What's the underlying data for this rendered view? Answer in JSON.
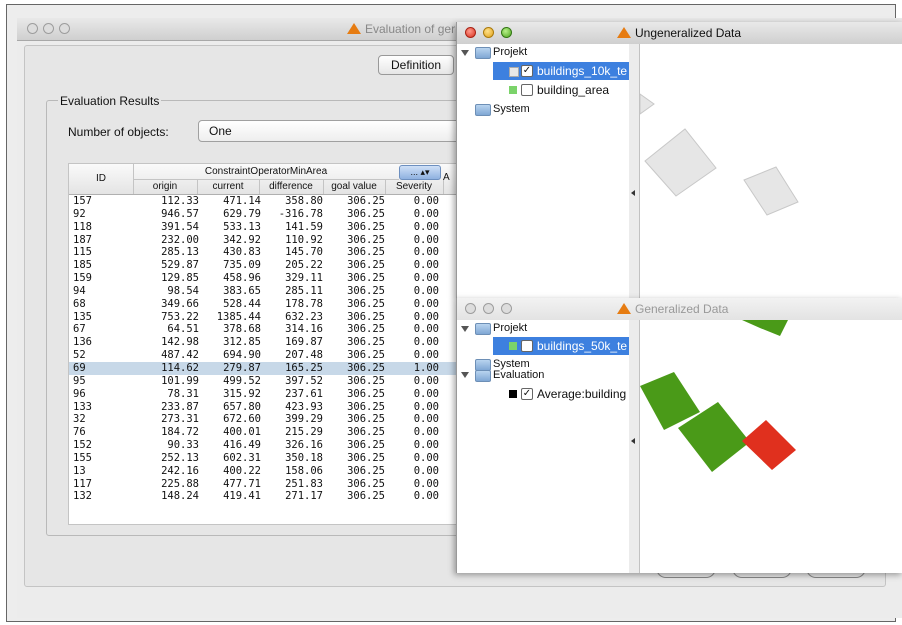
{
  "main_window": {
    "title": "Evaluation of ger",
    "tab": "Definition",
    "group_title": "Evaluation Results",
    "objects_label": "Number of objects:",
    "objects_value": "One",
    "table": {
      "col_id": "ID",
      "group_header": "ConstraintOperatorMinArea",
      "group_button": "...",
      "extra_col": "A",
      "sub_headers": [
        "origin",
        "current",
        "difference",
        "goal value",
        "Severity"
      ],
      "rows": [
        [
          "157",
          "112.33",
          "471.14",
          "358.80",
          "306.25",
          "0.00"
        ],
        [
          "92",
          "946.57",
          "629.79",
          "-316.78",
          "306.25",
          "0.00"
        ],
        [
          "118",
          "391.54",
          "533.13",
          "141.59",
          "306.25",
          "0.00"
        ],
        [
          "187",
          "232.00",
          "342.92",
          "110.92",
          "306.25",
          "0.00"
        ],
        [
          "115",
          "285.13",
          "430.83",
          "145.70",
          "306.25",
          "0.00"
        ],
        [
          "185",
          "529.87",
          "735.09",
          "205.22",
          "306.25",
          "0.00"
        ],
        [
          "159",
          "129.85",
          "458.96",
          "329.11",
          "306.25",
          "0.00"
        ],
        [
          "94",
          "98.54",
          "383.65",
          "285.11",
          "306.25",
          "0.00"
        ],
        [
          "68",
          "349.66",
          "528.44",
          "178.78",
          "306.25",
          "0.00"
        ],
        [
          "135",
          "753.22",
          "1385.44",
          "632.23",
          "306.25",
          "0.00"
        ],
        [
          "67",
          "64.51",
          "378.68",
          "314.16",
          "306.25",
          "0.00"
        ],
        [
          "136",
          "142.98",
          "312.85",
          "169.87",
          "306.25",
          "0.00"
        ],
        [
          "52",
          "487.42",
          "694.90",
          "207.48",
          "306.25",
          "0.00"
        ],
        [
          "69",
          "114.62",
          "279.87",
          "165.25",
          "306.25",
          "1.00"
        ],
        [
          "95",
          "101.99",
          "499.52",
          "397.52",
          "306.25",
          "0.00"
        ],
        [
          "96",
          "78.31",
          "315.92",
          "237.61",
          "306.25",
          "0.00"
        ],
        [
          "133",
          "233.87",
          "657.80",
          "423.93",
          "306.25",
          "0.00"
        ],
        [
          "32",
          "273.31",
          "672.60",
          "399.29",
          "306.25",
          "0.00"
        ],
        [
          "76",
          "184.72",
          "400.01",
          "215.29",
          "306.25",
          "0.00"
        ],
        [
          "152",
          "90.33",
          "416.49",
          "326.16",
          "306.25",
          "0.00"
        ],
        [
          "155",
          "252.13",
          "602.31",
          "350.18",
          "306.25",
          "0.00"
        ],
        [
          "13",
          "242.16",
          "400.22",
          "158.06",
          "306.25",
          "0.00"
        ],
        [
          "117",
          "225.88",
          "477.71",
          "251.83",
          "306.25",
          "0.00"
        ],
        [
          "132",
          "148.24",
          "419.41",
          "271.17",
          "306.25",
          "0.00"
        ]
      ],
      "selected_row": 13
    }
  },
  "ungeneralized": {
    "title": "Ungeneralized Data",
    "tree": {
      "root": "Projekt",
      "layer1": "buildings_10k_te",
      "layer2": "building_area",
      "system": "System"
    },
    "colors": {
      "fill": "#e6e6e6",
      "stroke": "#c8c8c8"
    }
  },
  "generalized": {
    "title": "Generalized Data",
    "tree": {
      "root": "Projekt",
      "layer1": "buildings_50k_te",
      "system": "System",
      "evaluation": "Evaluation",
      "eval_item": "Average:building"
    },
    "colors": {
      "green": "#4a9a18",
      "red": "#e0301e",
      "select": "#3d80df"
    }
  }
}
